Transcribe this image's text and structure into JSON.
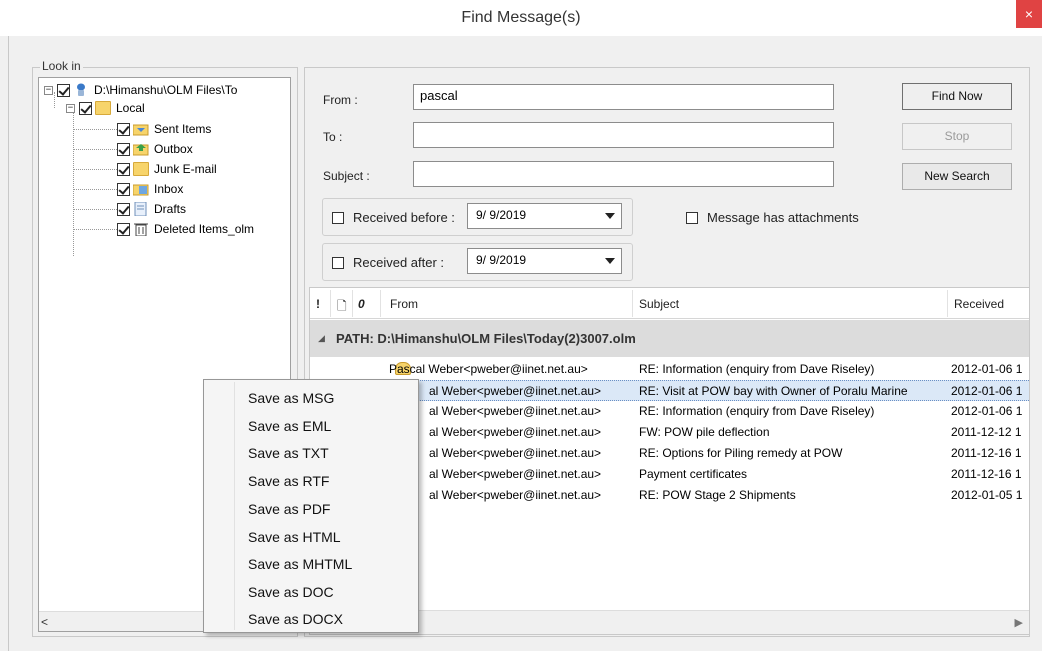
{
  "window": {
    "title": "Find Message(s)",
    "close_label": "×"
  },
  "look_in": {
    "legend": "Look in",
    "items": [
      {
        "label": "D:\\Himanshu\\OLM Files\\To",
        "type": "root"
      },
      {
        "label": "Local",
        "type": "folder"
      },
      {
        "label": "Sent Items",
        "type": "folder"
      },
      {
        "label": "Outbox",
        "type": "folder"
      },
      {
        "label": "Junk E-mail",
        "type": "folder"
      },
      {
        "label": "Inbox",
        "type": "folder"
      },
      {
        "label": "Drafts",
        "type": "folder"
      },
      {
        "label": "Deleted Items_olm",
        "type": "trash"
      }
    ],
    "scroll_left": "<"
  },
  "search": {
    "from_label": "From :",
    "from_value": "pascal",
    "to_label": "To :",
    "to_value": "",
    "subject_label": "Subject :",
    "subject_value": "",
    "find_now": "Find Now",
    "stop": "Stop",
    "new_search": "New Search",
    "received_before_label": "Received before :",
    "received_before_value": "9/ 9/2019",
    "received_after_label": "Received after :",
    "received_after_value": "9/ 9/2019",
    "has_attachments_label": "Message has attachments"
  },
  "grid": {
    "columns": {
      "importance": "!",
      "type": "🗋",
      "attachment": "0",
      "from": "From",
      "subject": "Subject",
      "received": "Received"
    },
    "path": "PATH: D:\\Himanshu\\OLM Files\\Today(2)3007.olm",
    "rows": [
      {
        "from": "Pascal Weber<pweber@iinet.net.au>",
        "subject": "RE: Information (enquiry from Dave Riseley)",
        "received": "2012-01-06 1"
      },
      {
        "from": "al Weber<pweber@iinet.net.au>",
        "subject": "RE: Visit at POW bay with Owner of Poralu Marine",
        "received": "2012-01-06 1"
      },
      {
        "from": "al Weber<pweber@iinet.net.au>",
        "subject": "RE: Information (enquiry from Dave Riseley)",
        "received": "2012-01-06 1"
      },
      {
        "from": "al Weber<pweber@iinet.net.au>",
        "subject": "FW: POW pile deflection",
        "received": "2011-12-12 1"
      },
      {
        "from": "al Weber<pweber@iinet.net.au>",
        "subject": "RE: Options for Piling remedy at POW",
        "received": "2011-12-16 1"
      },
      {
        "from": "al Weber<pweber@iinet.net.au>",
        "subject": "Payment certificates",
        "received": "2011-12-16 1"
      },
      {
        "from": "al Weber<pweber@iinet.net.au>",
        "subject": "RE: POW Stage 2 Shipments",
        "received": "2012-01-05 1"
      }
    ],
    "scroll_right": "▶"
  },
  "context_menu": {
    "items": [
      "Save as MSG",
      "Save as EML",
      "Save as TXT",
      "Save as RTF",
      "Save as PDF",
      "Save as HTML",
      "Save as MHTML",
      "Save as DOC",
      "Save as DOCX"
    ]
  }
}
